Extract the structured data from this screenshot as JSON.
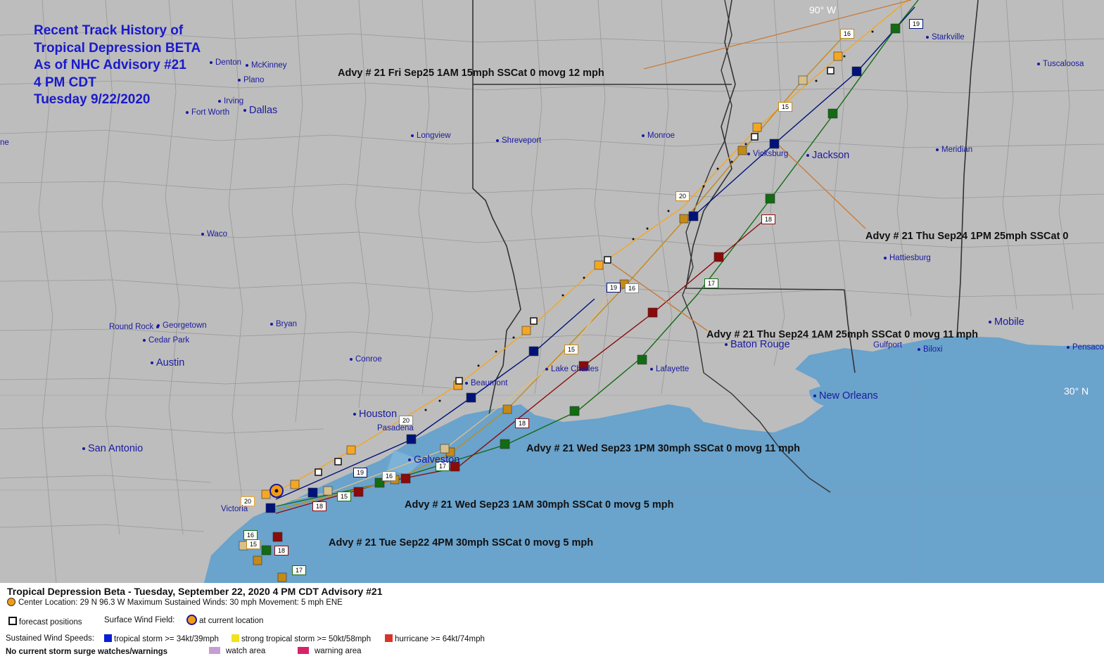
{
  "title_lines": [
    "Recent Track History of",
    "Tropical Depression BETA",
    "As of NHC Advisory #21",
    "4 PM CDT",
    "Tuesday 9/22/2020"
  ],
  "coordinate_labels": {
    "lon": "90° W",
    "lat": "30° N"
  },
  "cities": {
    "denton": "Denton",
    "mckinney": "McKinney",
    "plano": "Plano",
    "irving": "Irving",
    "fort_worth": "Fort Worth",
    "dallas": "Dallas",
    "longview": "Longview",
    "shreveport": "Shreveport",
    "monroe": "Monroe",
    "vicksburg": "Vicksburg",
    "jackson": "Jackson",
    "meridian": "Meridian",
    "starkville": "Starkville",
    "tuscaloosa": "Tuscaloosa",
    "waco": "Waco",
    "hattiesburg": "Hattiesburg",
    "round_rock": "Round Rock",
    "georgetown": "Georgetown",
    "bryan": "Bryan",
    "cedar_park": "Cedar Park",
    "austin": "Austin",
    "conroe": "Conroe",
    "beaumont": "Beaumont",
    "lake_charles": "Lake Charles",
    "lafayette": "Lafayette",
    "baton_rouge": "Baton Rouge",
    "gulfport": "Gulfport",
    "biloxi": "Biloxi",
    "mobile": "Mobile",
    "pensacola": "Pensaco",
    "new_orleans": "New Orleans",
    "houston": "Houston",
    "pasadena": "Pasadena",
    "galveston": "Galveston",
    "san_antonio": "San Antonio",
    "victoria": "Victoria",
    "edge_w": "ne"
  },
  "advisories": {
    "fri_sep25": "Advy # 21 Fri Sep25 1AM  15mph SSCat 0 movg 12 mph",
    "thu_sep24_1pm": "Advy # 21 Thu Sep24 1PM  25mph SSCat 0",
    "thu_sep24_1am": "Advy # 21 Thu Sep24 1AM  25mph SSCat 0 movg 11 mph",
    "wed_sep23_1pm": "Advy # 21 Wed Sep23 1PM  30mph SSCat 0 movg 11 mph",
    "wed_sep23_1am": "Advy # 21 Wed Sep23 1AM  30mph SSCat 0 movg 5 mph",
    "tue_sep22_4pm": "Advy # 21 Tue Sep22 4PM  30mph SSCat 0 movg 5 mph"
  },
  "model_tags": [
    "20",
    "19",
    "15",
    "16",
    "17",
    "18",
    "19",
    "16",
    "15",
    "20",
    "18",
    "17",
    "15",
    "19",
    "16",
    "17",
    "18",
    "15",
    "20",
    "16",
    "19"
  ],
  "legend": {
    "title": "Tropical Depression Beta  -  Tuesday, September 22, 2020  4 PM CDT   Advisory #21",
    "center_location": "Center Location: 29 N  96.3 W   Maximum Sustained Winds: 30 mph  Movement: 5 mph ENE",
    "forecast_positions": "forecast positions",
    "surface_wind_field": "Surface Wind Field:",
    "at_current_location": "at current location",
    "sustained_wind_speeds": "Sustained Wind Speeds:",
    "tropical_storm": "tropical storm >= 34kt/39mph",
    "strong_tropical_storm": "strong tropical storm >= 50kt/58mph",
    "hurricane": "hurricane >= 64kt/74mph",
    "no_surge": "No current storm surge watches/warnings",
    "watch_area": "watch area",
    "warning_area": "warning area"
  },
  "colors": {
    "land": "#bdbdbd",
    "water": "#6aa3cc",
    "tropical_storm": "#0a1fd6",
    "strong_ts": "#f2e21b",
    "hurricane": "#d9342b",
    "watch": "#c79ed1",
    "warning": "#d6246a",
    "track_orange": "#f5a623",
    "track_navy": "#00127a",
    "track_green": "#136b13",
    "track_maroon": "#8b0a0a",
    "track_olive": "#b8860b"
  }
}
